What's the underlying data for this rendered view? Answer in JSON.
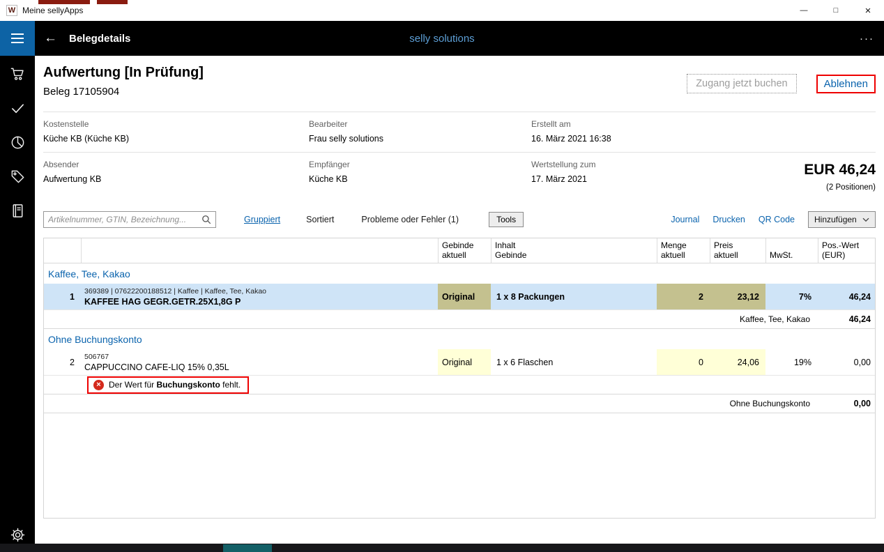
{
  "titlebar": {
    "icon_letter": "W",
    "app_title": "Meine sellyApps",
    "minimize": "—",
    "maximize": "□",
    "close": "×"
  },
  "appbar": {
    "back_icon": "←",
    "title": "Belegdetails",
    "brand": "selly solutions",
    "more_icon": "···"
  },
  "sidebar": {
    "icons": [
      "cart-icon",
      "check-icon",
      "pie-chart-icon",
      "tag-icon",
      "journal-icon"
    ],
    "settings_icon": "gear-icon"
  },
  "doc": {
    "title": "Aufwertung [In Prüfung]",
    "beleg": "Beleg 17105904",
    "btn_book": "Zugang jetzt buchen",
    "btn_reject": "Ablehnen",
    "meta": {
      "kostenstelle_label": "Kostenstelle",
      "kostenstelle": "Küche KB (Küche KB)",
      "bearbeiter_label": "Bearbeiter",
      "bearbeiter": "Frau selly solutions",
      "erstellt_label": "Erstellt am",
      "erstellt": "16. März 2021 16:38",
      "absender_label": "Absender",
      "absender": "Aufwertung KB",
      "empfaenger_label": "Empfänger",
      "empfaenger": "Küche KB",
      "wertstellung_label": "Wertstellung zum",
      "wertstellung": "17. März 2021"
    },
    "total": "EUR 46,24",
    "positions": "(2 Positionen)"
  },
  "toolbar": {
    "search_placeholder": "Artikelnummer, GTIN, Bezeichnung...",
    "grouped": "Gruppiert",
    "sorted": "Sortiert",
    "problems": "Probleme oder Fehler (1)",
    "tools": "Tools",
    "journal": "Journal",
    "print": "Drucken",
    "qr": "QR Code",
    "add": "Hinzufügen"
  },
  "table": {
    "headers": {
      "gebinde": "Gebinde\naktuell",
      "inhalt": "Inhalt\nGebinde",
      "menge": "Menge\naktuell",
      "preis": "Preis\naktuell",
      "mwst": "MwSt.",
      "wert": "Pos.-Wert\n(EUR)"
    },
    "group1": {
      "name": "Kaffee, Tee, Kakao",
      "row": {
        "pos": "1",
        "info": "369389 | 07622200188512 | Kaffee | Kaffee, Tee, Kakao",
        "name": "KAFFEE HAG GEGR.GETR.25X1,8G P",
        "gebinde": "Original",
        "inhalt": "1 x 8 Packungen",
        "menge": "2",
        "preis": "23,12",
        "mwst": "7%",
        "wert": "46,24"
      },
      "subtotal_label": "Kaffee, Tee, Kakao",
      "subtotal_value": "46,24"
    },
    "group2": {
      "name": "Ohne Buchungskonto",
      "row": {
        "pos": "2",
        "info": "506767",
        "name": "CAPPUCCINO CAFE-LIQ 15% 0,35L",
        "gebinde": "Original",
        "inhalt": "1 x 6 Flaschen",
        "menge": "0",
        "preis": "24,06",
        "mwst": "19%",
        "wert": "0,00"
      },
      "error": {
        "icon": "×",
        "prefix": "Der Wert für ",
        "bold": "Buchungskonto",
        "suffix": " fehlt."
      },
      "subtotal_label": "Ohne Buchungskonto",
      "subtotal_value": "0,00"
    }
  },
  "colors": {
    "accent_blue": "#0d63a5",
    "link_blue": "#0a63ad",
    "brand_blue": "#5d9fd6",
    "selected_row": "#cfe4f7",
    "changed_cell_selected": "#c4c18f",
    "changed_cell": "#ffffd7",
    "annotation_red": "#ee0000",
    "error_icon_red": "#d42a1c"
  }
}
